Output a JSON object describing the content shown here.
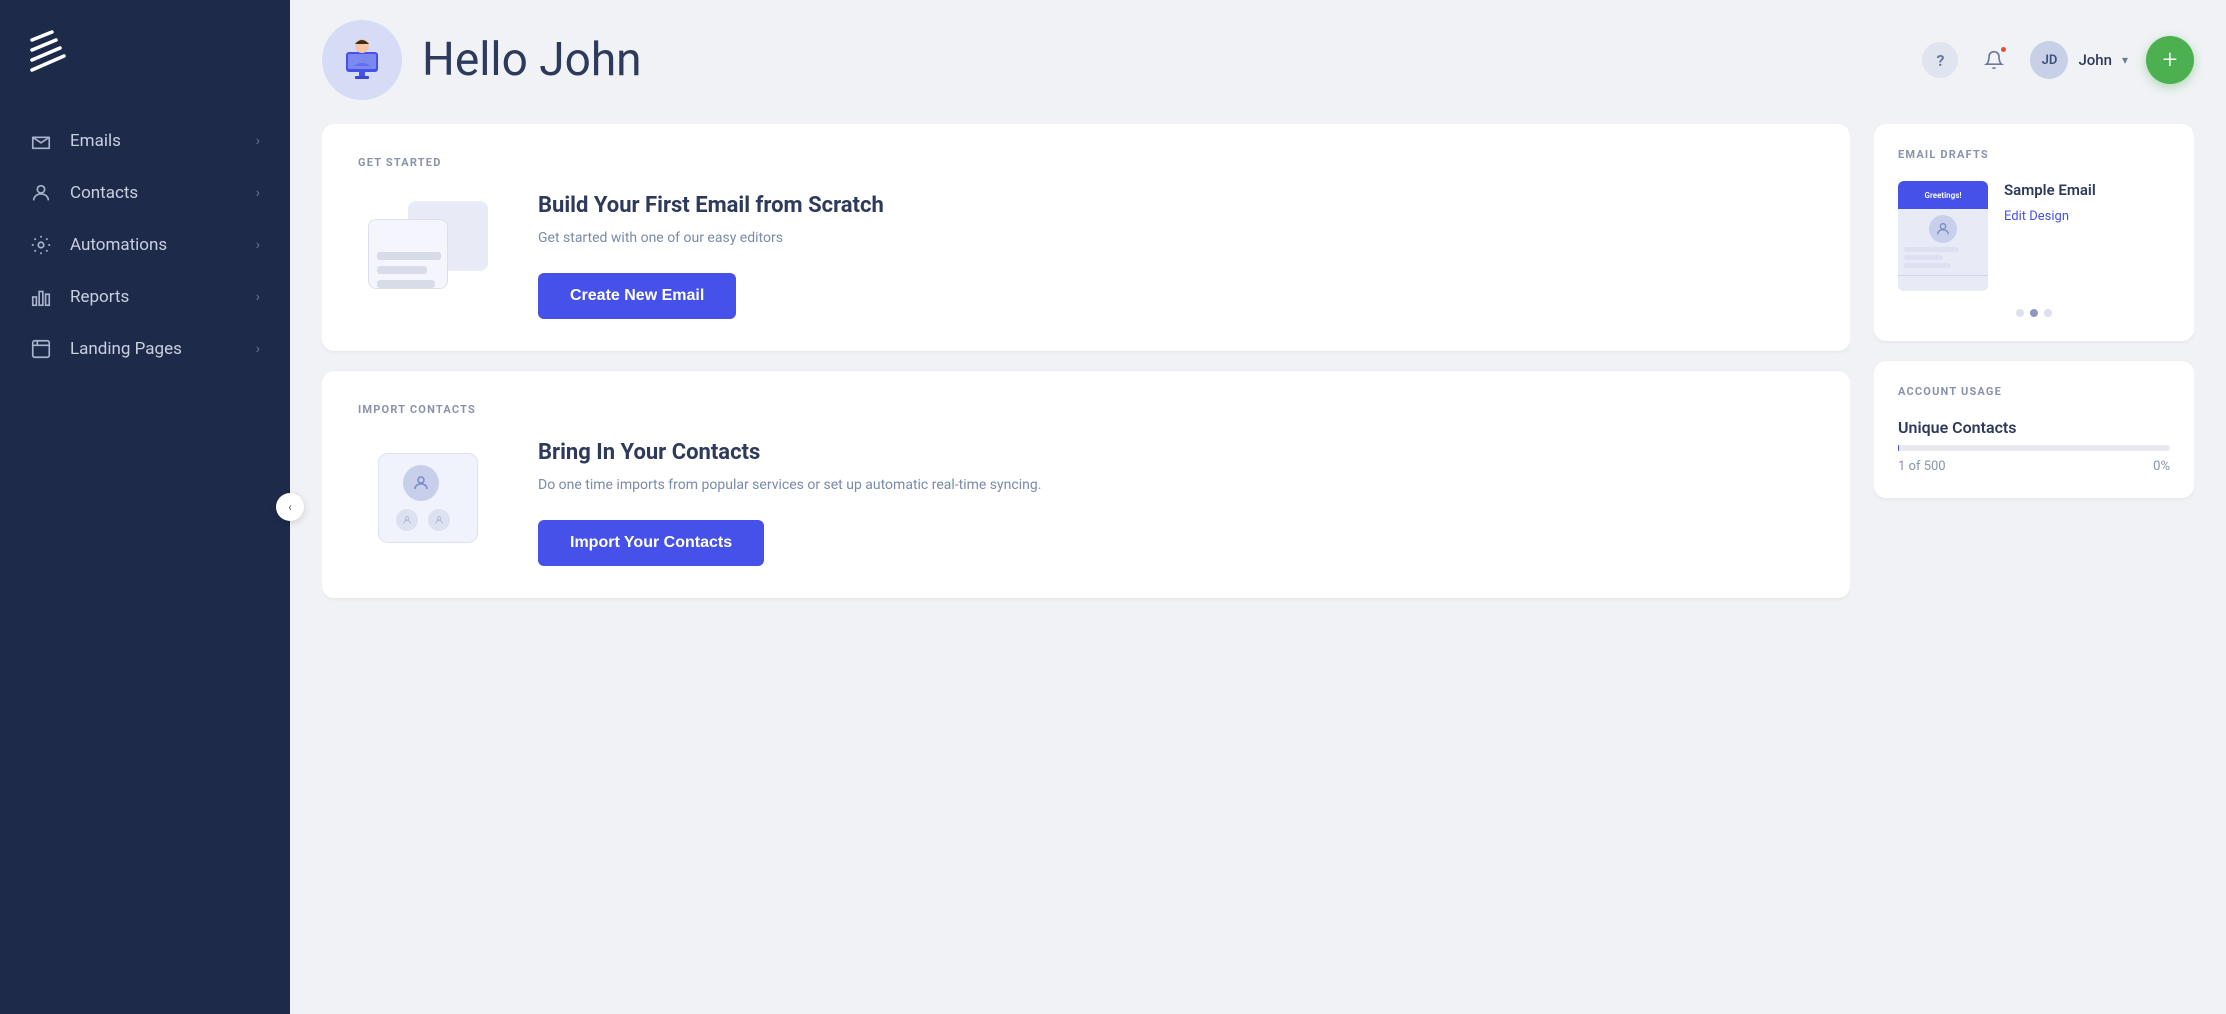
{
  "sidebar": {
    "logo_alt": "App Logo",
    "items": [
      {
        "id": "emails",
        "label": "Emails",
        "icon": "email-icon"
      },
      {
        "id": "contacts",
        "label": "Contacts",
        "icon": "contacts-icon"
      },
      {
        "id": "automations",
        "label": "Automations",
        "icon": "automations-icon"
      },
      {
        "id": "reports",
        "label": "Reports",
        "icon": "reports-icon"
      },
      {
        "id": "landing-pages",
        "label": "Landing Pages",
        "icon": "landing-pages-icon"
      }
    ]
  },
  "header": {
    "greeting": "Hello John",
    "help_label": "?",
    "user": {
      "initials": "JD",
      "name": "John",
      "chevron": "▾"
    },
    "fab_label": "+"
  },
  "get_started": {
    "section_label": "GET STARTED",
    "title": "Build Your First Email from Scratch",
    "description": "Get started with one of our easy editors",
    "button_label": "Create New Email"
  },
  "import_contacts": {
    "section_label": "IMPORT CONTACTS",
    "title": "Bring In Your Contacts",
    "description": "Do one time imports from popular services or set up automatic real-time syncing.",
    "button_label": "Import Your Contacts"
  },
  "email_drafts": {
    "section_title": "EMAIL DRAFTS",
    "draft": {
      "name": "Sample Email",
      "action_label": "Edit Design",
      "thumbnail_label": "Greetings!"
    },
    "dots": [
      false,
      true,
      false
    ]
  },
  "account_usage": {
    "section_title": "ACCOUNT USAGE",
    "unique_contacts": {
      "label": "Unique Contacts",
      "current": "1 of 500",
      "percent": "0%",
      "fill_width": "0.2%"
    }
  },
  "colors": {
    "sidebar_bg": "#1e2a4a",
    "accent": "#4551e8",
    "fab_green": "#4CAF50",
    "text_dark": "#2d3a5c",
    "text_muted": "#7a8aa8"
  }
}
